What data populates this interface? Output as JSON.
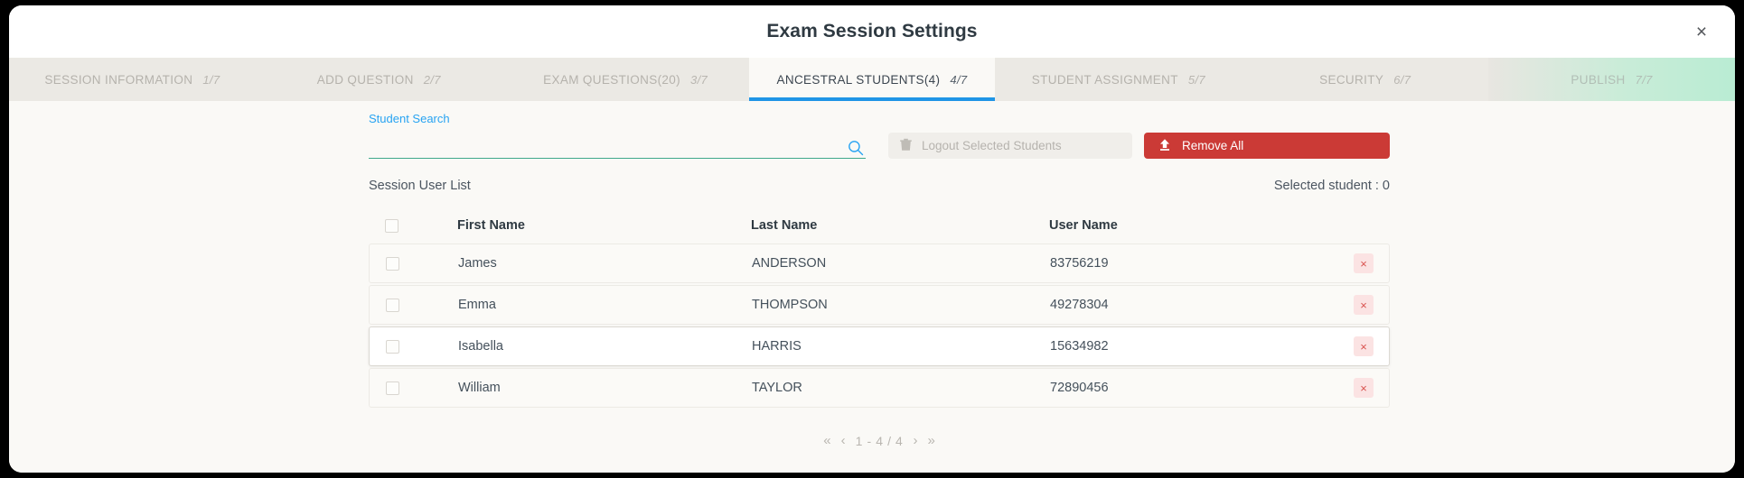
{
  "header": {
    "title": "Exam Session Settings",
    "close_label": "×"
  },
  "tabs": [
    {
      "label": "SESSION INFORMATION",
      "num": "1/7",
      "state": "inactive"
    },
    {
      "label": "ADD QUESTION",
      "num": "2/7",
      "state": "inactive"
    },
    {
      "label": "EXAM QUESTIONS(20)",
      "num": "3/7",
      "state": "inactive"
    },
    {
      "label": "ANCESTRAL STUDENTS(4)",
      "num": "4/7",
      "state": "active"
    },
    {
      "label": "STUDENT ASSIGNMENT",
      "num": "5/7",
      "state": "inactive"
    },
    {
      "label": "SECURITY",
      "num": "6/7",
      "state": "inactive"
    },
    {
      "label": "PUBLISH",
      "num": "7/7",
      "state": "publish"
    }
  ],
  "search": {
    "label": "Student Search",
    "value": "",
    "placeholder": "",
    "icon": "search-icon"
  },
  "actions": {
    "logout_label": "Logout Selected Students",
    "logout_icon": "trash-icon",
    "logout_disabled": true,
    "remove_all_label": "Remove All",
    "remove_all_icon": "upload-icon"
  },
  "list": {
    "title": "Session User List",
    "selected_text": "Selected student : 0",
    "columns": [
      "First Name",
      "Last Name",
      "User Name"
    ],
    "rows": [
      {
        "first": "James",
        "last": "ANDERSON",
        "user": "83756219",
        "checked": false,
        "hover": false,
        "delete_label": "×"
      },
      {
        "first": "Emma",
        "last": "THOMPSON",
        "user": "49278304",
        "checked": false,
        "hover": false,
        "delete_label": "×"
      },
      {
        "first": "Isabella",
        "last": "HARRIS",
        "user": "15634982",
        "checked": false,
        "hover": true,
        "delete_label": "×"
      },
      {
        "first": "William",
        "last": "TAYLOR",
        "user": "72890456",
        "checked": false,
        "hover": false,
        "delete_label": "×"
      }
    ]
  },
  "pagination": {
    "first": "«",
    "prev": "‹",
    "info": "1 - 4 / 4",
    "next": "›",
    "last": "»"
  },
  "colors": {
    "accent_blue": "#1f95e6",
    "link_blue": "#27a3f2",
    "underline_green": "#3fa98a",
    "danger_red": "#cb3a36",
    "row_delete_red": "#d9534f",
    "publish_green": "#b9ecd3",
    "body_bg": "#faf9f6",
    "tabstrip_bg": "#ebe9e4"
  }
}
